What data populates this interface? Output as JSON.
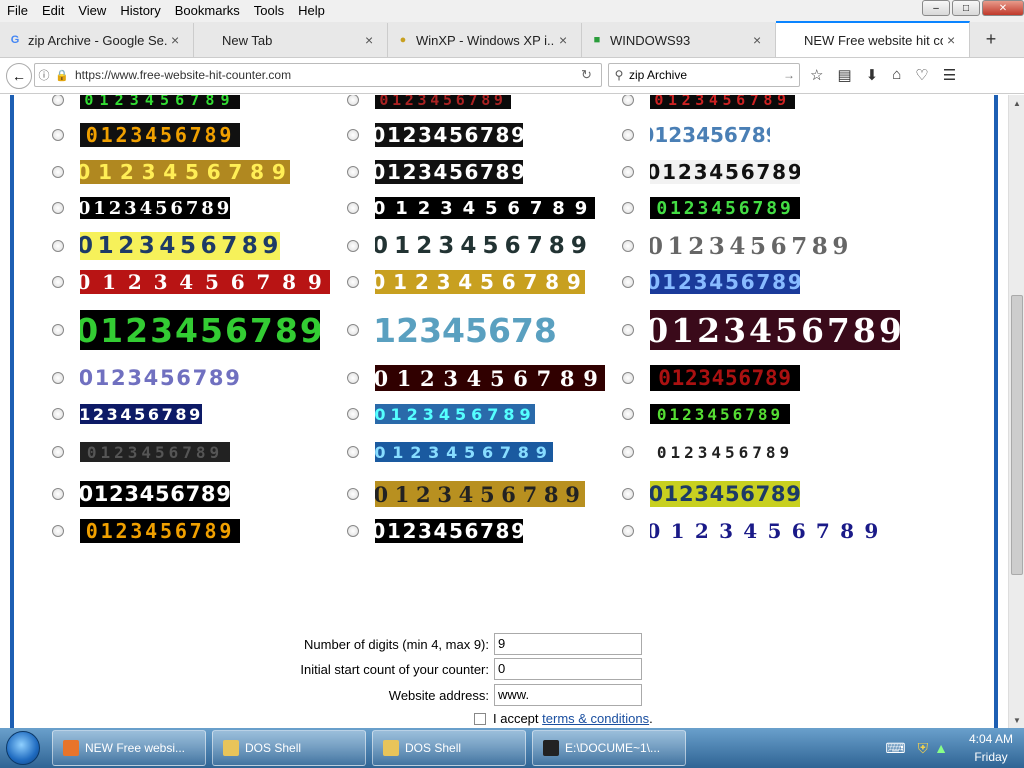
{
  "menubar": {
    "items": [
      "File",
      "Edit",
      "View",
      "History",
      "Bookmarks",
      "Tools",
      "Help"
    ]
  },
  "tabs": [
    {
      "label": "zip Archive - Google Se...",
      "favicon": "G",
      "color": "#4285f4"
    },
    {
      "label": "New Tab",
      "favicon": "",
      "color": "#888"
    },
    {
      "label": "WinXP - Windows XP i...",
      "favicon": "●",
      "color": "#c8a020"
    },
    {
      "label": "WINDOWS93",
      "favicon": "■",
      "color": "#2a9d3b"
    },
    {
      "label": "NEW Free website hit count...",
      "favicon": "",
      "color": "#888"
    }
  ],
  "navbar": {
    "url": "https://www.free-website-hit-counter.com",
    "search_value": "zip Archive"
  },
  "counter_digits": "0123456789",
  "counter_digits_short": "123456789",
  "counter_styles": [
    {
      "bg": "#0a0a0a",
      "fg": "#33dd33",
      "font": "mono"
    },
    {
      "bg": "#0a0a0a",
      "fg": "#aa2222",
      "font": "mono"
    },
    {
      "bg": "#0a0a0a",
      "fg": "#cc2222",
      "font": "mono"
    },
    {
      "bg": "#111111",
      "fg": "#f0a000",
      "font": "mono"
    },
    {
      "bg": "#111111",
      "fg": "#ffffff",
      "font": "sans"
    },
    {
      "bg": "#ffffff",
      "fg": "#4a7fb5",
      "font": "sans"
    },
    {
      "bg": "#b08820",
      "fg": "#ffee55",
      "font": "sans"
    },
    {
      "bg": "#111111",
      "fg": "#ffffff",
      "font": "sans"
    },
    {
      "bg": "#f2f2f2",
      "fg": "#111111",
      "font": "sans"
    },
    {
      "bg": "#000000",
      "fg": "#ffffff",
      "font": "serif"
    },
    {
      "bg": "#000000",
      "fg": "#ffffff",
      "font": "sans"
    },
    {
      "bg": "#000000",
      "fg": "#44dd44",
      "font": "mono"
    },
    {
      "bg": "#f6f15a",
      "fg": "#1d3a66",
      "font": "sans"
    },
    {
      "bg": "#ffffff",
      "fg": "#223333",
      "font": "sans"
    },
    {
      "bg": "#ffffff",
      "fg": "#666666",
      "font": "serif"
    },
    {
      "bg": "#b81414",
      "fg": "#ffffff",
      "font": "serif"
    },
    {
      "bg": "#c8a020",
      "fg": "#ffffff",
      "font": "sans"
    },
    {
      "bg": "#1a3a9a",
      "fg": "#88bbff",
      "font": "sans"
    },
    {
      "bg": "#000000",
      "fg": "#33cc33",
      "font": "sans"
    },
    {
      "bg": "#ffffff",
      "fg": "#5aa0c0",
      "font": "sans"
    },
    {
      "bg": "#3a0a1a",
      "fg": "#ffffff",
      "font": "serif"
    },
    {
      "bg": "#ffffff",
      "fg": "#7070c0",
      "font": "sans"
    },
    {
      "bg": "#300000",
      "fg": "#ffffff",
      "font": "serif"
    },
    {
      "bg": "#000000",
      "fg": "#aa1111",
      "font": "mono"
    },
    {
      "bg": "#0d1a66",
      "fg": "#ffffff",
      "font": "sans"
    },
    {
      "bg": "#2a6aaa",
      "fg": "#55ffff",
      "font": "sans"
    },
    {
      "bg": "#000000",
      "fg": "#55dd33",
      "font": "mono"
    },
    {
      "bg": "#222222",
      "fg": "#555555",
      "font": "mono"
    },
    {
      "bg": "#1a5aa0",
      "fg": "#88ddff",
      "font": "sans"
    },
    {
      "bg": "#ffffff",
      "fg": "#222222",
      "font": "mono"
    },
    {
      "bg": "#000000",
      "fg": "#ffffff",
      "font": "sans"
    },
    {
      "bg": "#b89020",
      "fg": "#222222",
      "font": "serif"
    },
    {
      "bg": "#c8d020",
      "fg": "#1d3a66",
      "font": "sans"
    },
    {
      "bg": "#000000",
      "fg": "#f0a000",
      "font": "mono"
    },
    {
      "bg": "#000000",
      "fg": "#ffffff",
      "font": "sans"
    },
    {
      "bg": "#ffffff",
      "fg": "#1a1a88",
      "font": "serif"
    }
  ],
  "form": {
    "digits_label": "Number of digits (min 4, max 9):",
    "digits_value": "9",
    "start_label": "Initial start count of your counter:",
    "start_value": "0",
    "website_label": "Website address:",
    "website_value": "www.",
    "accept_prefix": "I accept ",
    "accept_link": "terms & conditions",
    "accept_suffix": "."
  },
  "taskbar": {
    "tasks": [
      {
        "label": "NEW Free websi...",
        "color": "#e8742a"
      },
      {
        "label": "DOS Shell",
        "color": "#e8c45a"
      },
      {
        "label": "DOS Shell",
        "color": "#e8c45a"
      },
      {
        "label": "E:\\DOCUME~1\\...",
        "color": "#222222"
      }
    ],
    "time": "4:04 AM",
    "day": "Friday"
  }
}
